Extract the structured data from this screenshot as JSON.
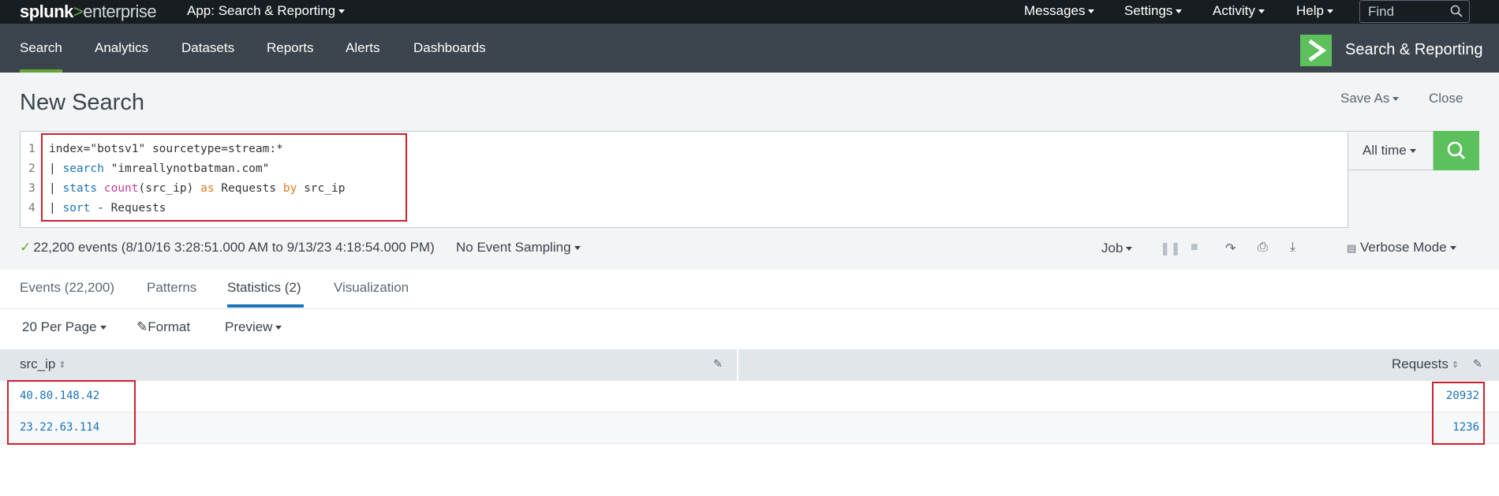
{
  "topbar": {
    "logo_splunk": "splunk",
    "logo_gt": ">",
    "logo_enterprise": "enterprise",
    "app_menu": "App: Search & Reporting",
    "messages": "Messages",
    "settings": "Settings",
    "activity": "Activity",
    "help": "Help",
    "find_placeholder": "Find"
  },
  "nav": {
    "tabs": [
      "Search",
      "Analytics",
      "Datasets",
      "Reports",
      "Alerts",
      "Dashboards"
    ],
    "active_tab": "Search",
    "app_name": "Search & Reporting"
  },
  "search": {
    "title": "New Search",
    "save_as": "Save As",
    "close": "Close",
    "line_numbers": [
      "1",
      "2",
      "3",
      "4"
    ],
    "query_lines": [
      "index=\"botsv1\" sourcetype=stream:*",
      "| search \"imreallynotbatman.com\"",
      "| stats count(src_ip) as Requests by src_ip",
      "| sort - Requests"
    ],
    "time_range": "All time"
  },
  "status": {
    "events_summary": "22,200 events (8/10/16 3:28:51.000 AM to 9/13/23 4:18:54.000 PM)",
    "sampling": "No Event Sampling",
    "job": "Job",
    "mode": "Verbose Mode"
  },
  "result_tabs": [
    "Events (22,200)",
    "Patterns",
    "Statistics (2)",
    "Visualization"
  ],
  "active_result_tab": "Statistics (2)",
  "toolbar": {
    "per_page": "20 Per Page",
    "format": "Format",
    "preview": "Preview"
  },
  "table": {
    "columns": [
      "src_ip",
      "Requests"
    ],
    "rows": [
      {
        "src_ip": "40.80.148.42",
        "requests": "20932"
      },
      {
        "src_ip": "23.22.63.114",
        "requests": "1236"
      }
    ]
  },
  "colors": {
    "accent_green": "#5cc05c",
    "highlight_red": "#d0202d",
    "link_blue": "#1a73b8"
  }
}
